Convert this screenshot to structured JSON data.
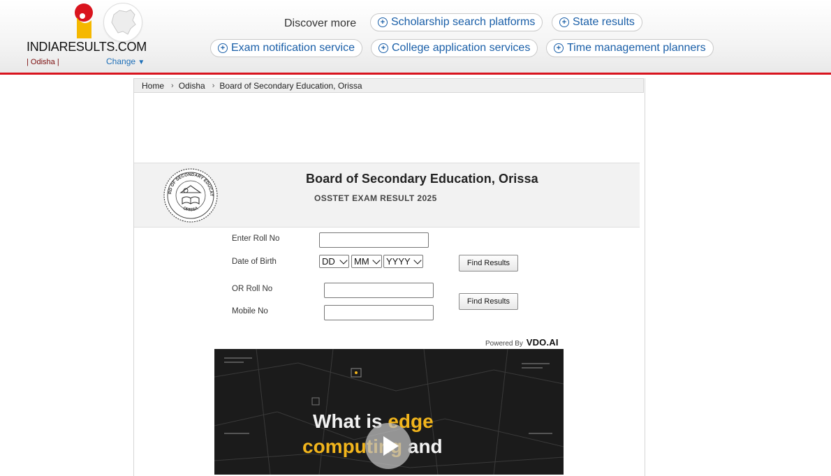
{
  "brand": {
    "logo_text": "INDIARESULTS.COM",
    "region": "| Odisha |",
    "change_label": "Change",
    "accent_color": "#d9141e",
    "link_color": "#1a5fa8"
  },
  "discover": {
    "label": "Discover more",
    "chips": [
      {
        "label": "Scholarship search platforms",
        "icon": "plus-circle-icon"
      },
      {
        "label": "State results",
        "icon": "plus-circle-icon"
      },
      {
        "label": "Exam notification service",
        "icon": "plus-circle-icon"
      },
      {
        "label": "College application services",
        "icon": "plus-circle-icon"
      },
      {
        "label": "Time management planners",
        "icon": "plus-circle-icon"
      }
    ]
  },
  "breadcrumb": [
    "Home",
    "Odisha",
    "Board of Secondary Education, Orissa"
  ],
  "board": {
    "title": "Board of Secondary Education, Orissa",
    "exam": "OSSTET EXAM RESULT 2025",
    "seal_top": "BOARD OF SECONDARY EDUCATION",
    "seal_bottom": "ORISSA"
  },
  "form": {
    "roll_label": "Enter Roll No",
    "dob_label": "Date of Birth",
    "dob_day": "DD",
    "dob_month": "MM",
    "dob_year": "YYYY",
    "find_label": "Find Results",
    "or_roll_label": "OR Roll No",
    "mobile_label": "Mobile No",
    "find_label_2": "Find Results"
  },
  "ad": {
    "powered_by": "Powered By",
    "vendor": "VDO.AI",
    "line1_a": "What is ",
    "line1_b": "edge",
    "line2_a": "computing",
    "line2_b": " and"
  }
}
